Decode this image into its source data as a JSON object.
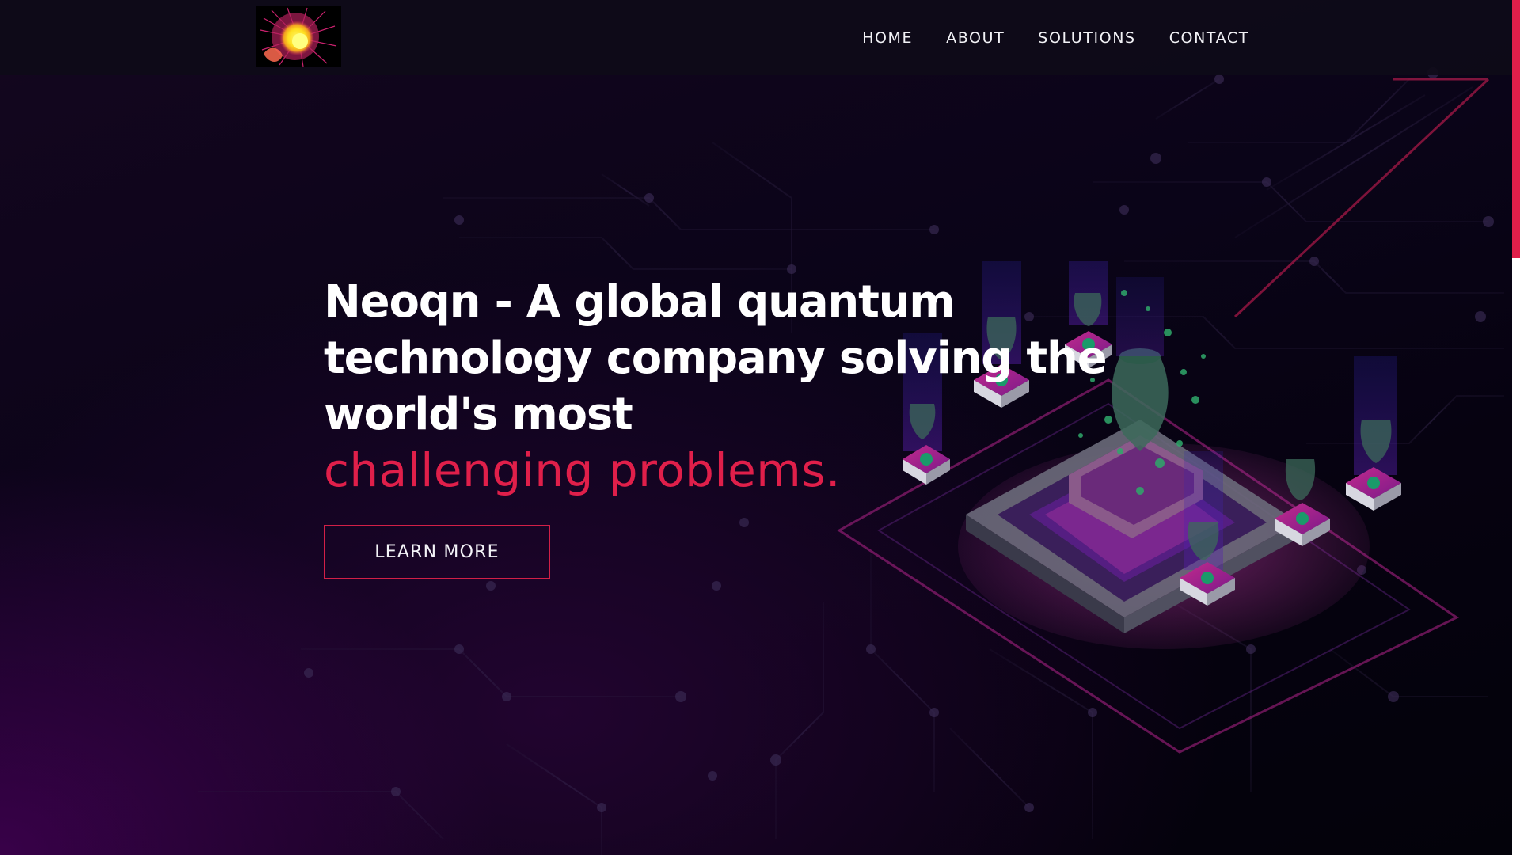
{
  "header": {
    "logo_alt": "Neoqn logo",
    "nav": [
      {
        "label": "HOME"
      },
      {
        "label": "ABOUT"
      },
      {
        "label": "SOLUTIONS"
      },
      {
        "label": "CONTACT"
      }
    ]
  },
  "hero": {
    "title_lines": [
      "Neoqn - A global quantum",
      "technology company solving the",
      "world's most"
    ],
    "title_accent": "challenging problems.",
    "cta_label": "LEARN MORE"
  },
  "colors": {
    "accent": "#e01f4a",
    "background": "#0a0418",
    "navbar": "#0e0b18",
    "text": "#ffffff"
  },
  "scroll": {
    "position_fraction": 0.0
  }
}
